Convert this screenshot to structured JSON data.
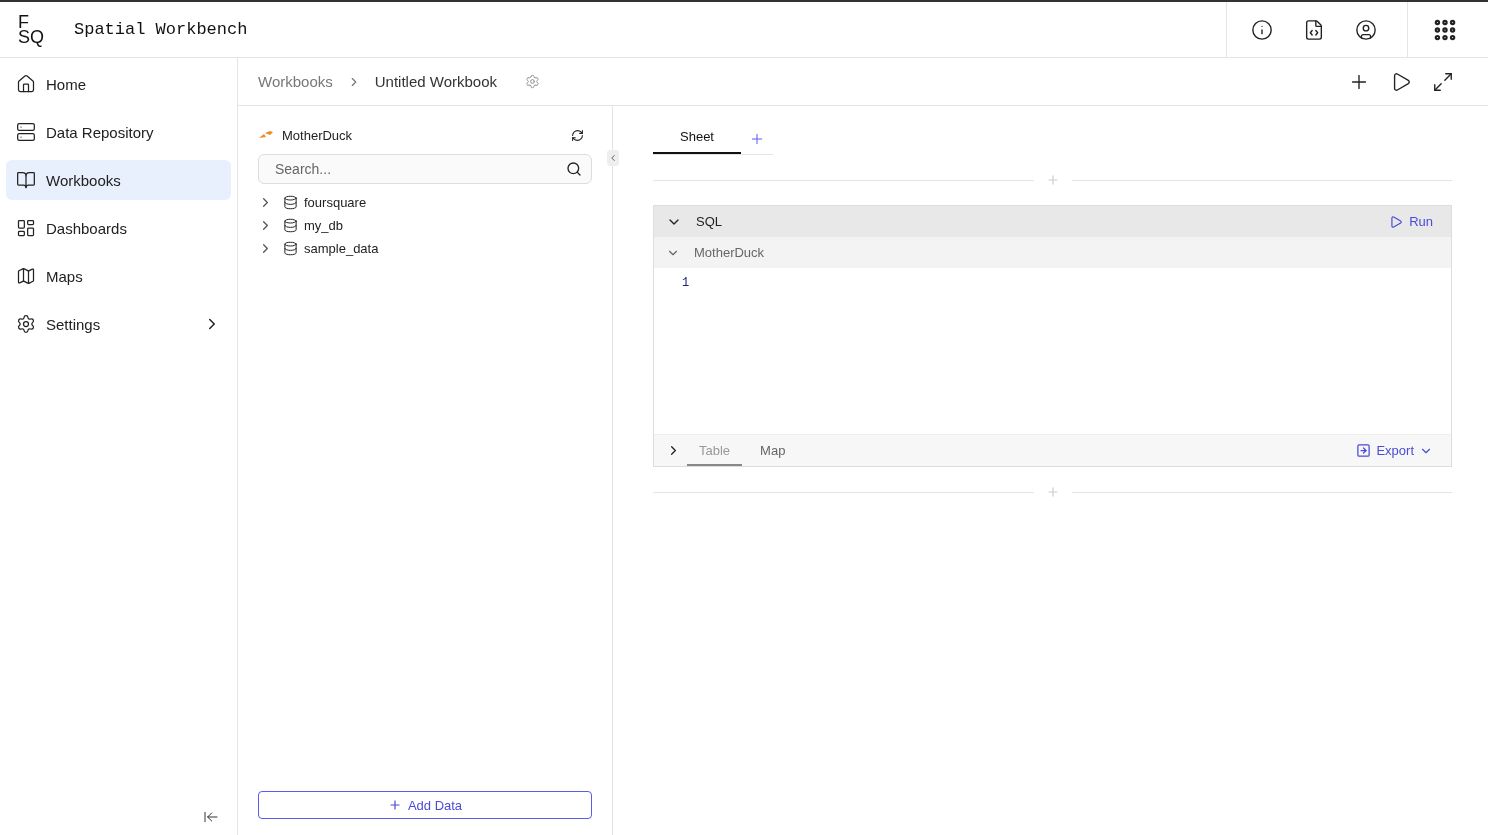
{
  "header": {
    "logo_lines": [
      "F",
      "SQ"
    ],
    "title": "Spatial Workbench"
  },
  "nav": [
    {
      "label": "Home",
      "selected": false,
      "submenu": false
    },
    {
      "label": "Data Repository",
      "selected": false,
      "submenu": false
    },
    {
      "label": "Workbooks",
      "selected": true,
      "submenu": false
    },
    {
      "label": "Dashboards",
      "selected": false,
      "submenu": false
    },
    {
      "label": "Maps",
      "selected": false,
      "submenu": false
    },
    {
      "label": "Settings",
      "selected": false,
      "submenu": true
    }
  ],
  "breadcrumb": [
    "Workbooks",
    "Untitled Workbook"
  ],
  "source": {
    "name": "MotherDuck",
    "search": {
      "placeholder": "Search..."
    },
    "databases": [
      {
        "name": "foursquare",
        "expanded": false
      },
      {
        "name": "my_db",
        "expanded": false
      },
      {
        "name": "sample_data",
        "expanded": false
      }
    ],
    "add_button": "Add Data"
  },
  "sheet_tabs": [
    {
      "label": "Sheet",
      "selected": true
    }
  ],
  "cell": {
    "type": "SQL",
    "expanded": true,
    "run": "Run",
    "connection": "MotherDuck",
    "line_numbers": [
      "1"
    ],
    "result_expanded": false,
    "result_tabs": [
      {
        "label": "Table",
        "selected": true
      },
      {
        "label": "Map",
        "selected": false
      }
    ],
    "export": "Export"
  }
}
